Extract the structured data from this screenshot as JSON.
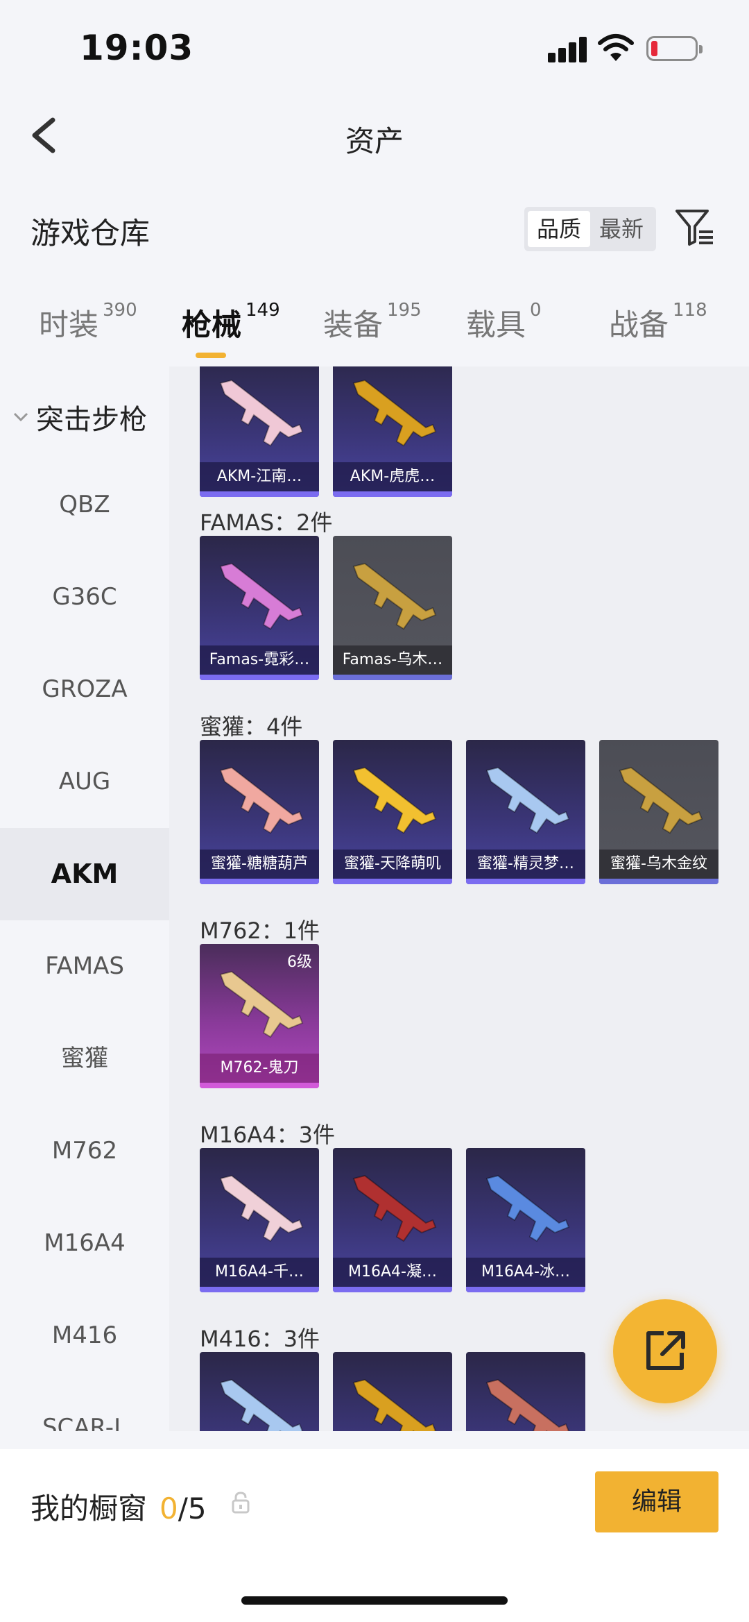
{
  "status": {
    "time": "19:03"
  },
  "nav": {
    "title": "资产"
  },
  "warehouse": {
    "title": "游戏仓库",
    "sort_quality": "品质",
    "sort_latest": "最新"
  },
  "tabs": [
    {
      "label": "时装",
      "count": "390"
    },
    {
      "label": "枪械",
      "count": "149"
    },
    {
      "label": "装备",
      "count": "195"
    },
    {
      "label": "载具",
      "count": "0"
    },
    {
      "label": "战备",
      "count": "118"
    }
  ],
  "sidebar": {
    "category": "突击步枪",
    "items": [
      "QBZ",
      "G36C",
      "GROZA",
      "AUG",
      "AKM",
      "FAMAS",
      "蜜獾",
      "M762",
      "M16A4",
      "M416",
      "SCAR-L"
    ],
    "selected": "AKM"
  },
  "groups": [
    {
      "title": "",
      "items": [
        {
          "label": "AKM-江南…",
          "style": "purple",
          "gun_color": "#f0c8d6"
        },
        {
          "label": "AKM-虎虎…",
          "style": "purple",
          "gun_color": "#d9a020"
        }
      ]
    },
    {
      "title": "FAMAS：2件",
      "items": [
        {
          "label": "Famas-霓彩…",
          "style": "purple",
          "gun_color": "#d77cd6"
        },
        {
          "label": "Famas-乌木…",
          "style": "gray",
          "gun_color": "#c8a040"
        }
      ]
    },
    {
      "title": "蜜獾：4件",
      "items": [
        {
          "label": "蜜獾-糖糖葫芦",
          "style": "purple",
          "gun_color": "#f0a8a0"
        },
        {
          "label": "蜜獾-天降萌叽",
          "style": "purple",
          "gun_color": "#f2c030"
        },
        {
          "label": "蜜獾-精灵梦…",
          "style": "purple",
          "gun_color": "#a8c8f0"
        },
        {
          "label": "蜜獾-乌木金纹",
          "style": "gray",
          "gun_color": "#c8a040"
        }
      ]
    },
    {
      "title": "M762：1件",
      "items": [
        {
          "label": "M762-鬼刀",
          "style": "pink",
          "gun_color": "#e8c890",
          "level": "6级"
        }
      ]
    },
    {
      "title": "M16A4：3件",
      "items": [
        {
          "label": "M16A4-千…",
          "style": "purple",
          "gun_color": "#f0d0d8"
        },
        {
          "label": "M16A4-凝…",
          "style": "purple",
          "gun_color": "#b03030"
        },
        {
          "label": "M16A4-冰…",
          "style": "purple",
          "gun_color": "#5a8ae0"
        }
      ]
    },
    {
      "title": "M416：3件",
      "items": [
        {
          "label": "",
          "style": "purple",
          "gun_color": "#a8c8f0"
        },
        {
          "label": "",
          "style": "purple",
          "gun_color": "#d9a020"
        },
        {
          "label": "",
          "style": "purple",
          "gun_color": "#c87060"
        }
      ]
    }
  ],
  "showcase": {
    "title": "我的橱窗",
    "count": "0",
    "total": "/5",
    "edit": "编辑"
  }
}
